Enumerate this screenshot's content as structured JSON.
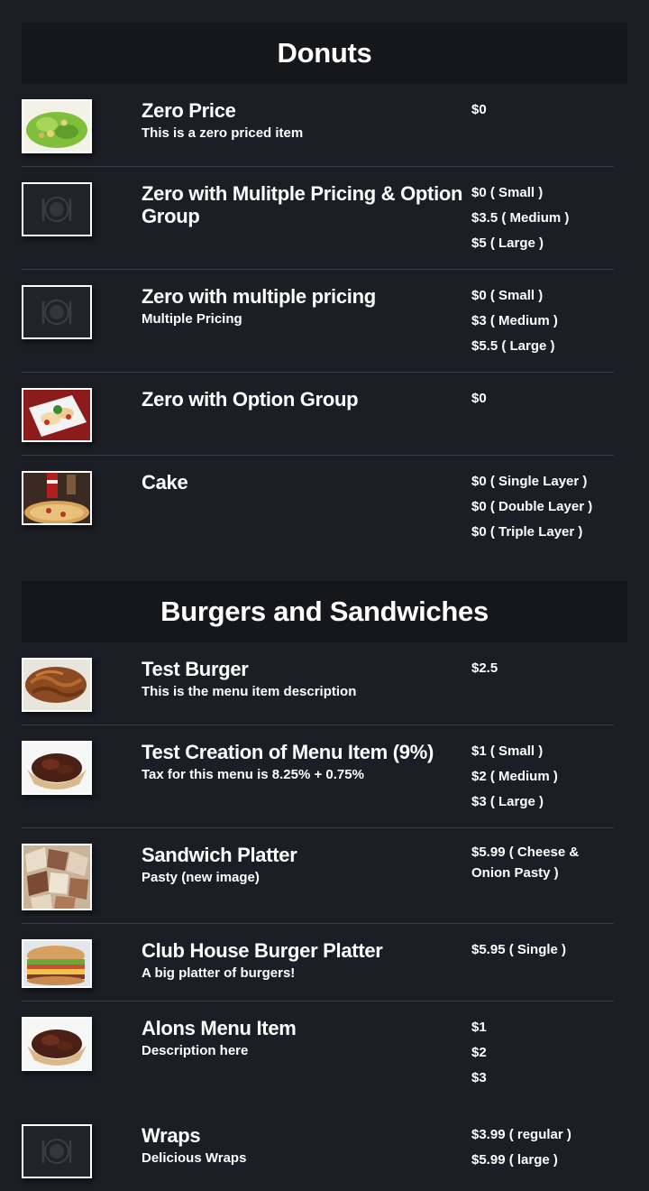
{
  "sections": [
    {
      "title": "Donuts",
      "items": [
        {
          "name": "Zero Price",
          "desc": "This is a zero priced item",
          "prices": [
            "$0"
          ],
          "image": "salad-photo"
        },
        {
          "name": "Zero with Mulitple Pricing & Option Group",
          "desc": "",
          "prices": [
            "$0 ( Small )",
            "$3.5 ( Medium )",
            "$5 ( Large )"
          ],
          "image": "placeholder-icon"
        },
        {
          "name": "Zero with multiple pricing",
          "desc": "Multiple Pricing",
          "prices": [
            "$0 ( Small )",
            "$3 ( Medium )",
            "$5.5 ( Large )"
          ],
          "image": "placeholder-icon"
        },
        {
          "name": "Zero with Option Group",
          "desc": "",
          "prices": [
            "$0"
          ],
          "image": "ravioli-photo"
        },
        {
          "name": "Cake",
          "desc": "",
          "prices": [
            "$0 ( Single Layer )",
            "$0 ( Double Layer )",
            "$0 ( Triple Layer )"
          ],
          "image": "pizza-cola-photo"
        }
      ]
    },
    {
      "title": "Burgers and Sandwiches",
      "items": [
        {
          "name": "Test Burger",
          "desc": "This is the menu item description",
          "prices": [
            "$2.5"
          ],
          "image": "pulled-meat-photo"
        },
        {
          "name": "Test Creation of Menu Item (9%)",
          "desc": "Tax for this menu is 8.25% + 0.75%",
          "prices": [
            "$1 ( Small )",
            "$2 ( Medium )",
            "$3 ( Large )"
          ],
          "image": "meat-bowl-photo"
        },
        {
          "name": "Sandwich Platter",
          "desc": "Pasty (new image)",
          "prices": [
            "$5.99 ( Cheese & Onion Pasty )"
          ],
          "image": "sandwich-platter-photo"
        },
        {
          "name": "Club House Burger Platter",
          "desc": "A big platter of burgers!",
          "prices": [
            "$5.95 ( Single )"
          ],
          "image": "burger-photo"
        },
        {
          "name": "Alons Menu Item",
          "desc": "Description here",
          "prices": [
            "$1",
            "$2",
            "$3"
          ],
          "image": "meat-bowl-photo"
        },
        {
          "name": "Wraps",
          "desc": "Delicious Wraps",
          "prices": [
            "$3.99 ( regular )",
            "$5.99 ( large )"
          ],
          "image": "placeholder-icon"
        }
      ]
    }
  ],
  "colors": {
    "background": "#1c1e25",
    "header": "#16171c",
    "divider": "#3a3d45",
    "text": "#ffffff"
  }
}
